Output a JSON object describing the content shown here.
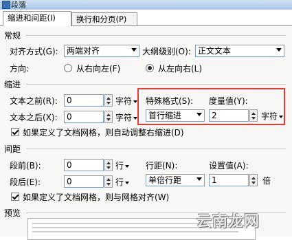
{
  "window": {
    "title": "段落"
  },
  "tabs": [
    {
      "label": "缩进和间距(I)"
    },
    {
      "label": "换行和分页(P)"
    }
  ],
  "general": {
    "heading": "常规",
    "alignment_label": "对齐方式(G):",
    "alignment_value": "两端对齐",
    "outline_label": "大纲级别(O):",
    "outline_value": "正文文本",
    "direction_label": "方向:",
    "rtl_label": "从右向左(F)",
    "ltr_label": "从左向右(L)"
  },
  "indent": {
    "heading": "缩进",
    "before_label": "文本之前(R):",
    "before_value": "0",
    "before_unit": "字符",
    "after_label": "文本之后(X):",
    "after_value": "0",
    "after_unit": "字符",
    "special_label": "特殊格式(S):",
    "special_value": "首行缩进",
    "measure_label": "度量值(Y):",
    "measure_value": "2",
    "measure_unit": "字符",
    "grid_checkbox_label": "如果定义了文档网格，则自动调整右缩进(D)"
  },
  "spacing": {
    "heading": "间距",
    "before_label": "段前(B):",
    "before_value": "0",
    "before_unit": "行",
    "after_label": "段后(E):",
    "after_value": "0",
    "after_unit": "行",
    "line_label": "行距(N):",
    "line_value": "单倍行距",
    "setting_label": "设置值(A):",
    "setting_value": "1",
    "setting_unit": "倍",
    "grid_checkbox_label": "如果定义了文档网格，则与网格对齐(W)"
  },
  "preview": {
    "heading": "预览"
  },
  "watermark": {
    "text": "云南龙网"
  },
  "colors": {
    "highlight_border": "#e53935"
  }
}
